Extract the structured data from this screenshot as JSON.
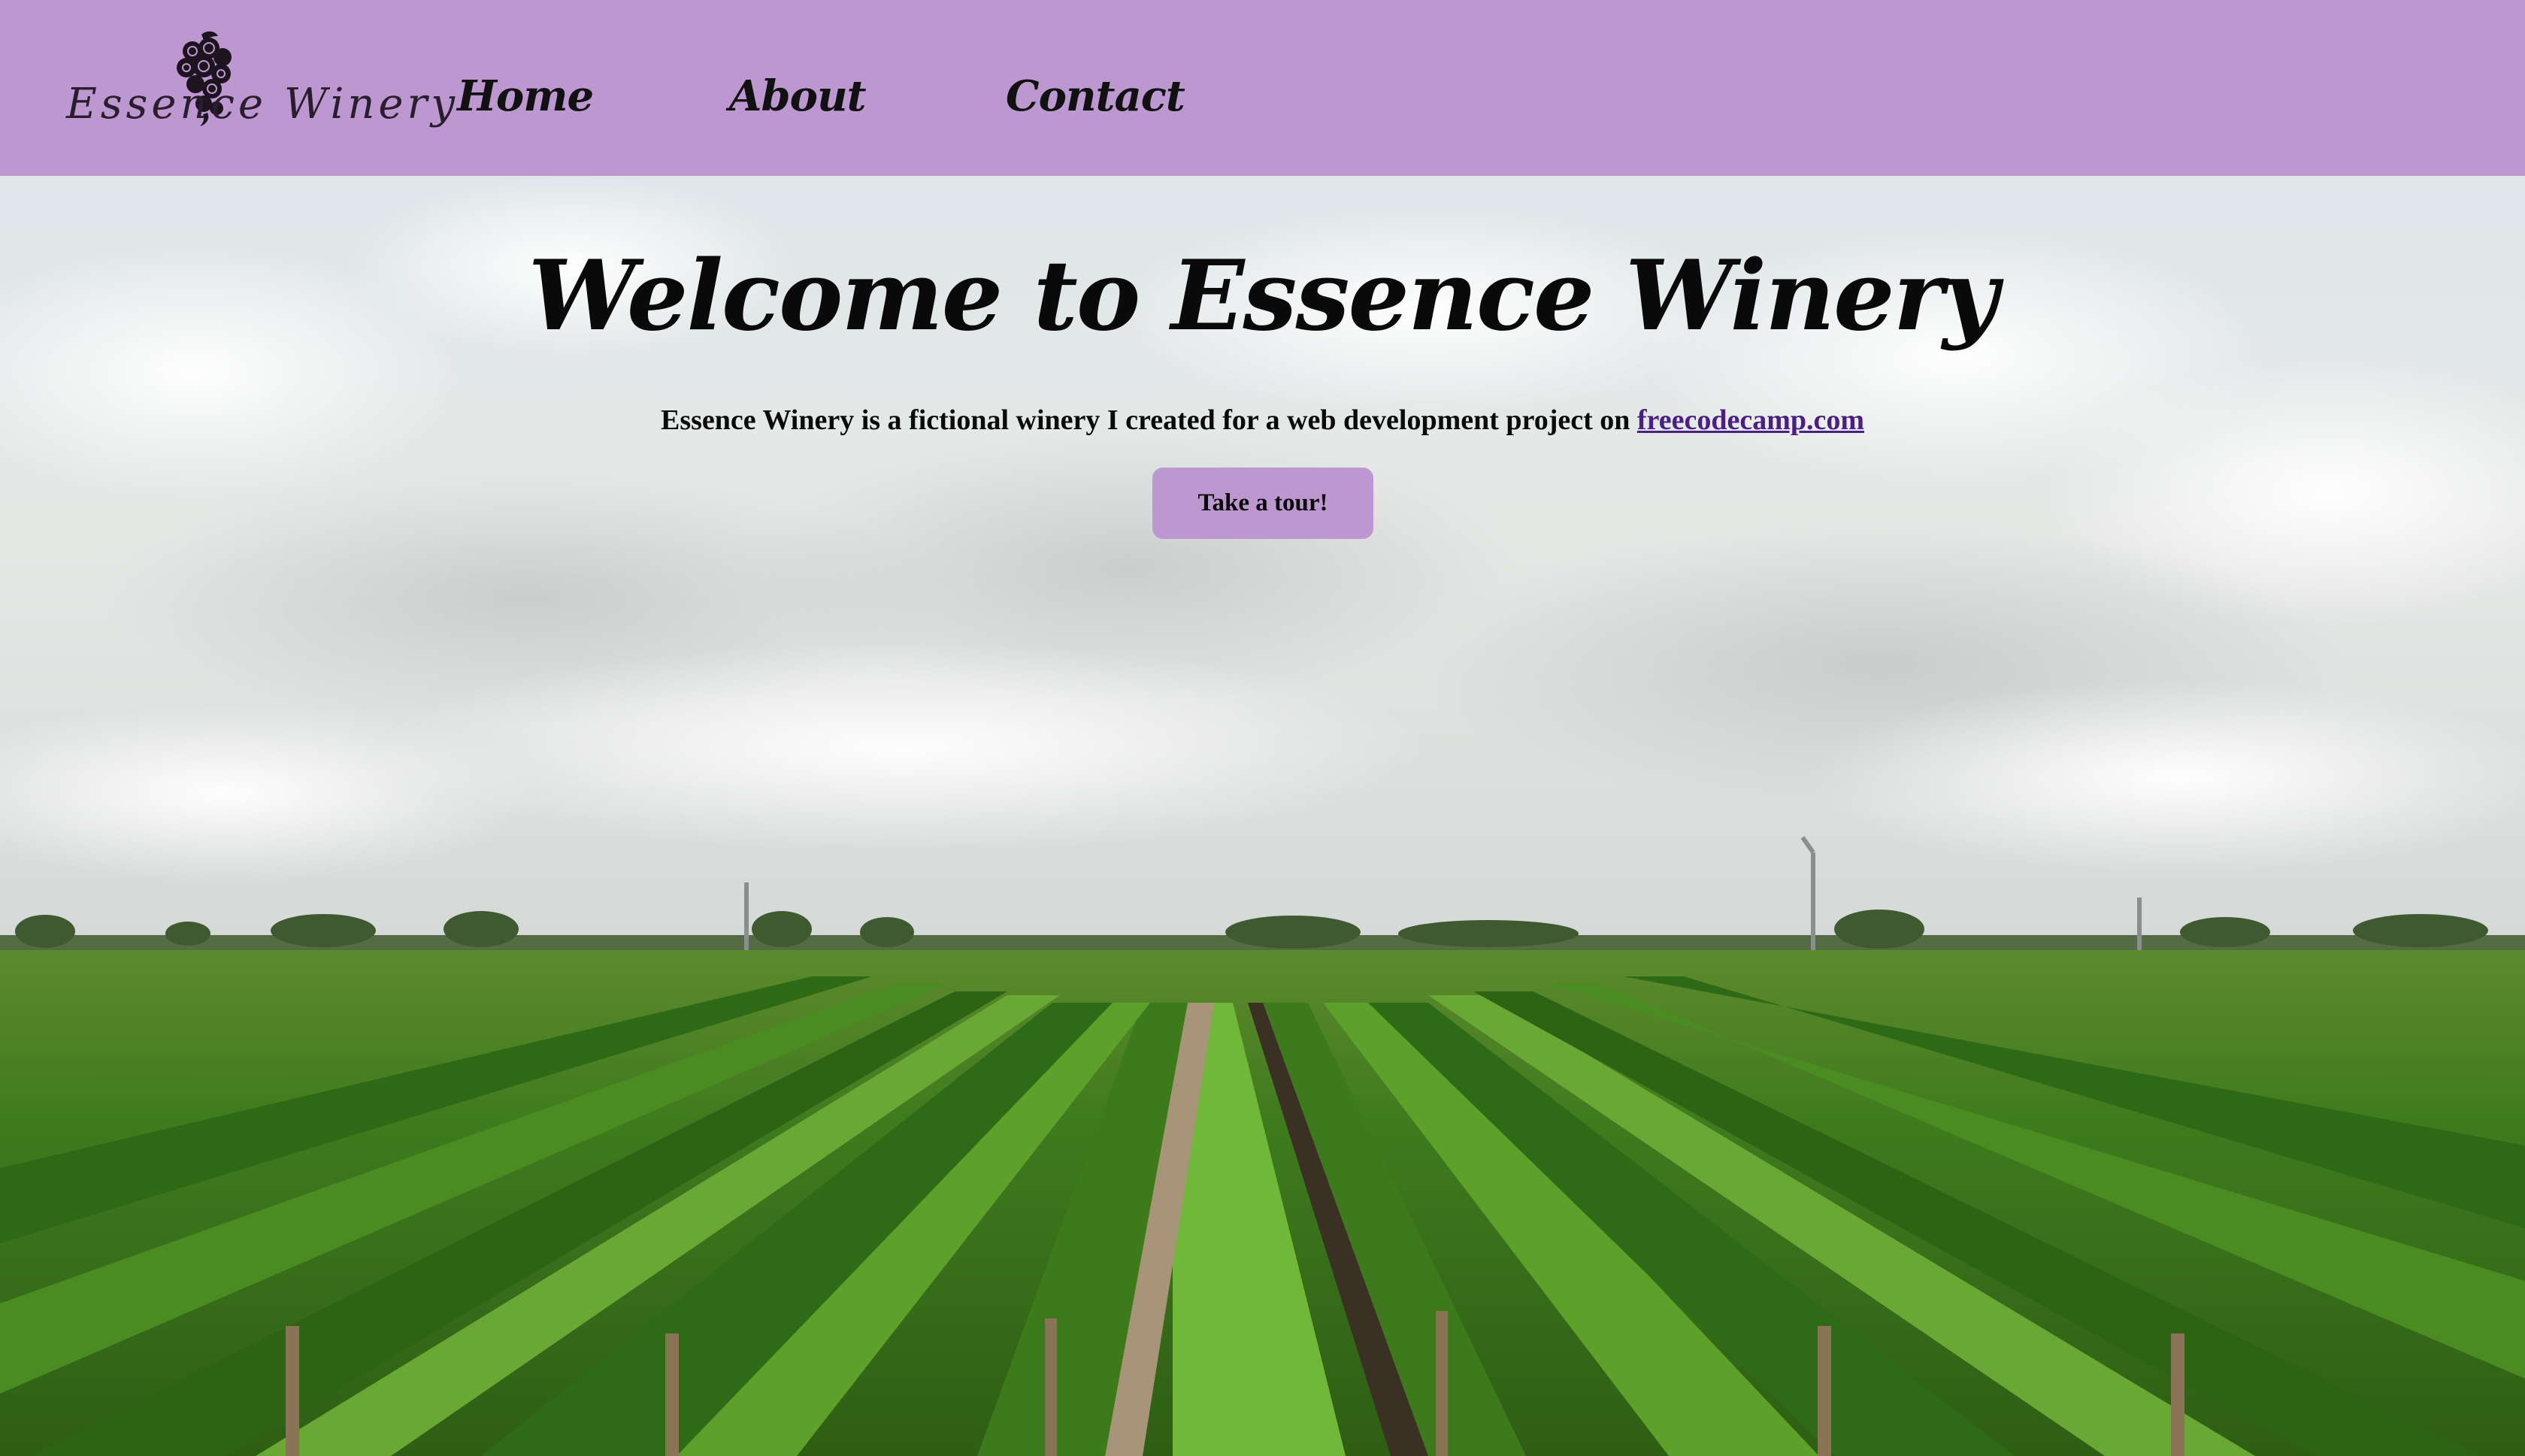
{
  "nav": {
    "logo_text": "Essence Winery",
    "items": [
      {
        "label": "Home"
      },
      {
        "label": "About"
      },
      {
        "label": "Contact"
      }
    ]
  },
  "hero": {
    "title": "Welcome to Essence Winery",
    "subtitle_prefix": "Essence Winery is a fictional winery I created for a web development project on ",
    "subtitle_link": "freecodecamp.com",
    "button_label": "Take a tour!"
  },
  "colors": {
    "nav_background": "#bd98d0",
    "button_background": "#bd98d0",
    "link": "#4b1f84"
  }
}
